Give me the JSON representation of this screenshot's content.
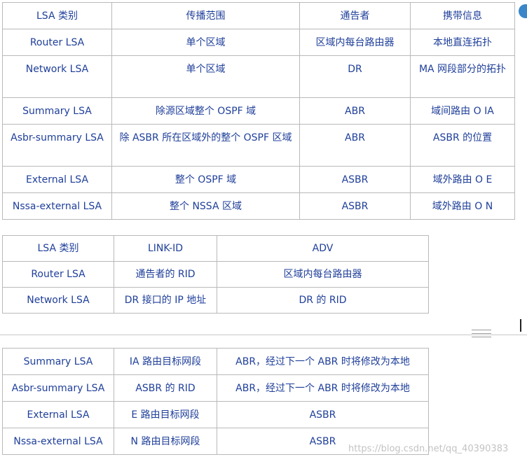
{
  "table1": {
    "headers": [
      "LSA 类别",
      "传播范围",
      "通告者",
      "携带信息"
    ],
    "rows": [
      [
        "Router LSA",
        "单个区域",
        "区域内每台路由器",
        "本地直连拓扑"
      ],
      [
        "Network LSA",
        "单个区域",
        "DR",
        "MA 网段部分的拓扑"
      ],
      [
        "Summary LSA",
        "除源区域整个 OSPF 域",
        "ABR",
        "域间路由  O IA"
      ],
      [
        "Asbr-summary LSA",
        "除 ASBR 所在区域外的整个 OSPF 区域",
        "ABR",
        "ASBR 的位置"
      ],
      [
        "External LSA",
        "整个 OSPF 域",
        "ASBR",
        "域外路由  O E"
      ],
      [
        "Nssa-external LSA",
        "整个 NSSA 区域",
        "ASBR",
        "域外路由  O N"
      ]
    ]
  },
  "table2": {
    "headers": [
      "LSA 类别",
      "LINK-ID",
      "ADV"
    ],
    "rows": [
      [
        "Router LSA",
        "通告者的 RID",
        "区域内每台路由器"
      ],
      [
        "Network LSA",
        "DR 接口的 IP 地址",
        "DR 的 RID"
      ]
    ]
  },
  "table3": {
    "rows": [
      [
        "Summary LSA",
        "IA 路由目标网段",
        "ABR，经过下一个 ABR 时将修改为本地"
      ],
      [
        "Asbr-summary LSA",
        "ASBR 的 RID",
        "ABR，经过下一个 ABR 时将修改为本地"
      ],
      [
        "External LSA",
        "E 路由目标网段",
        "ASBR"
      ],
      [
        "Nssa-external LSA",
        "N 路由目标网段",
        "ASBR"
      ]
    ]
  },
  "watermark": "https://blog.csdn.net/qq_40390383"
}
